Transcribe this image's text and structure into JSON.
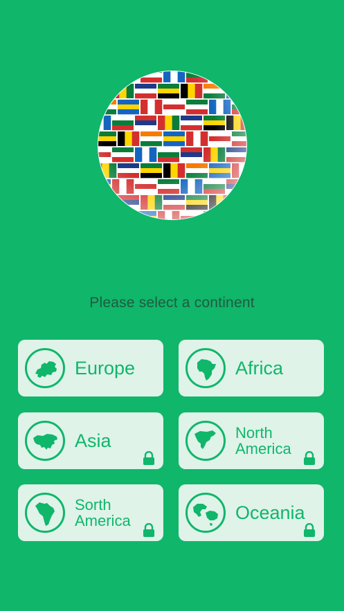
{
  "colors": {
    "background": "#10b66a",
    "card": "#dff3e9",
    "accent": "#10b66a",
    "prompt_text": "#1f5a3e"
  },
  "header": {
    "logo_icon": "flag-globe-icon"
  },
  "prompt": "Please select a continent",
  "continents": [
    {
      "label": "Europe",
      "icon": "europe-map-icon",
      "locked": false
    },
    {
      "label": "Africa",
      "icon": "africa-map-icon",
      "locked": false
    },
    {
      "label": "Asia",
      "icon": "asia-map-icon",
      "locked": true
    },
    {
      "label": "North\nAmerica",
      "icon": "north-america-map-icon",
      "locked": true
    },
    {
      "label": "Sorth\nAmerica",
      "icon": "south-america-map-icon",
      "locked": true
    },
    {
      "label": "Oceania",
      "icon": "oceania-map-icon",
      "locked": true
    }
  ]
}
